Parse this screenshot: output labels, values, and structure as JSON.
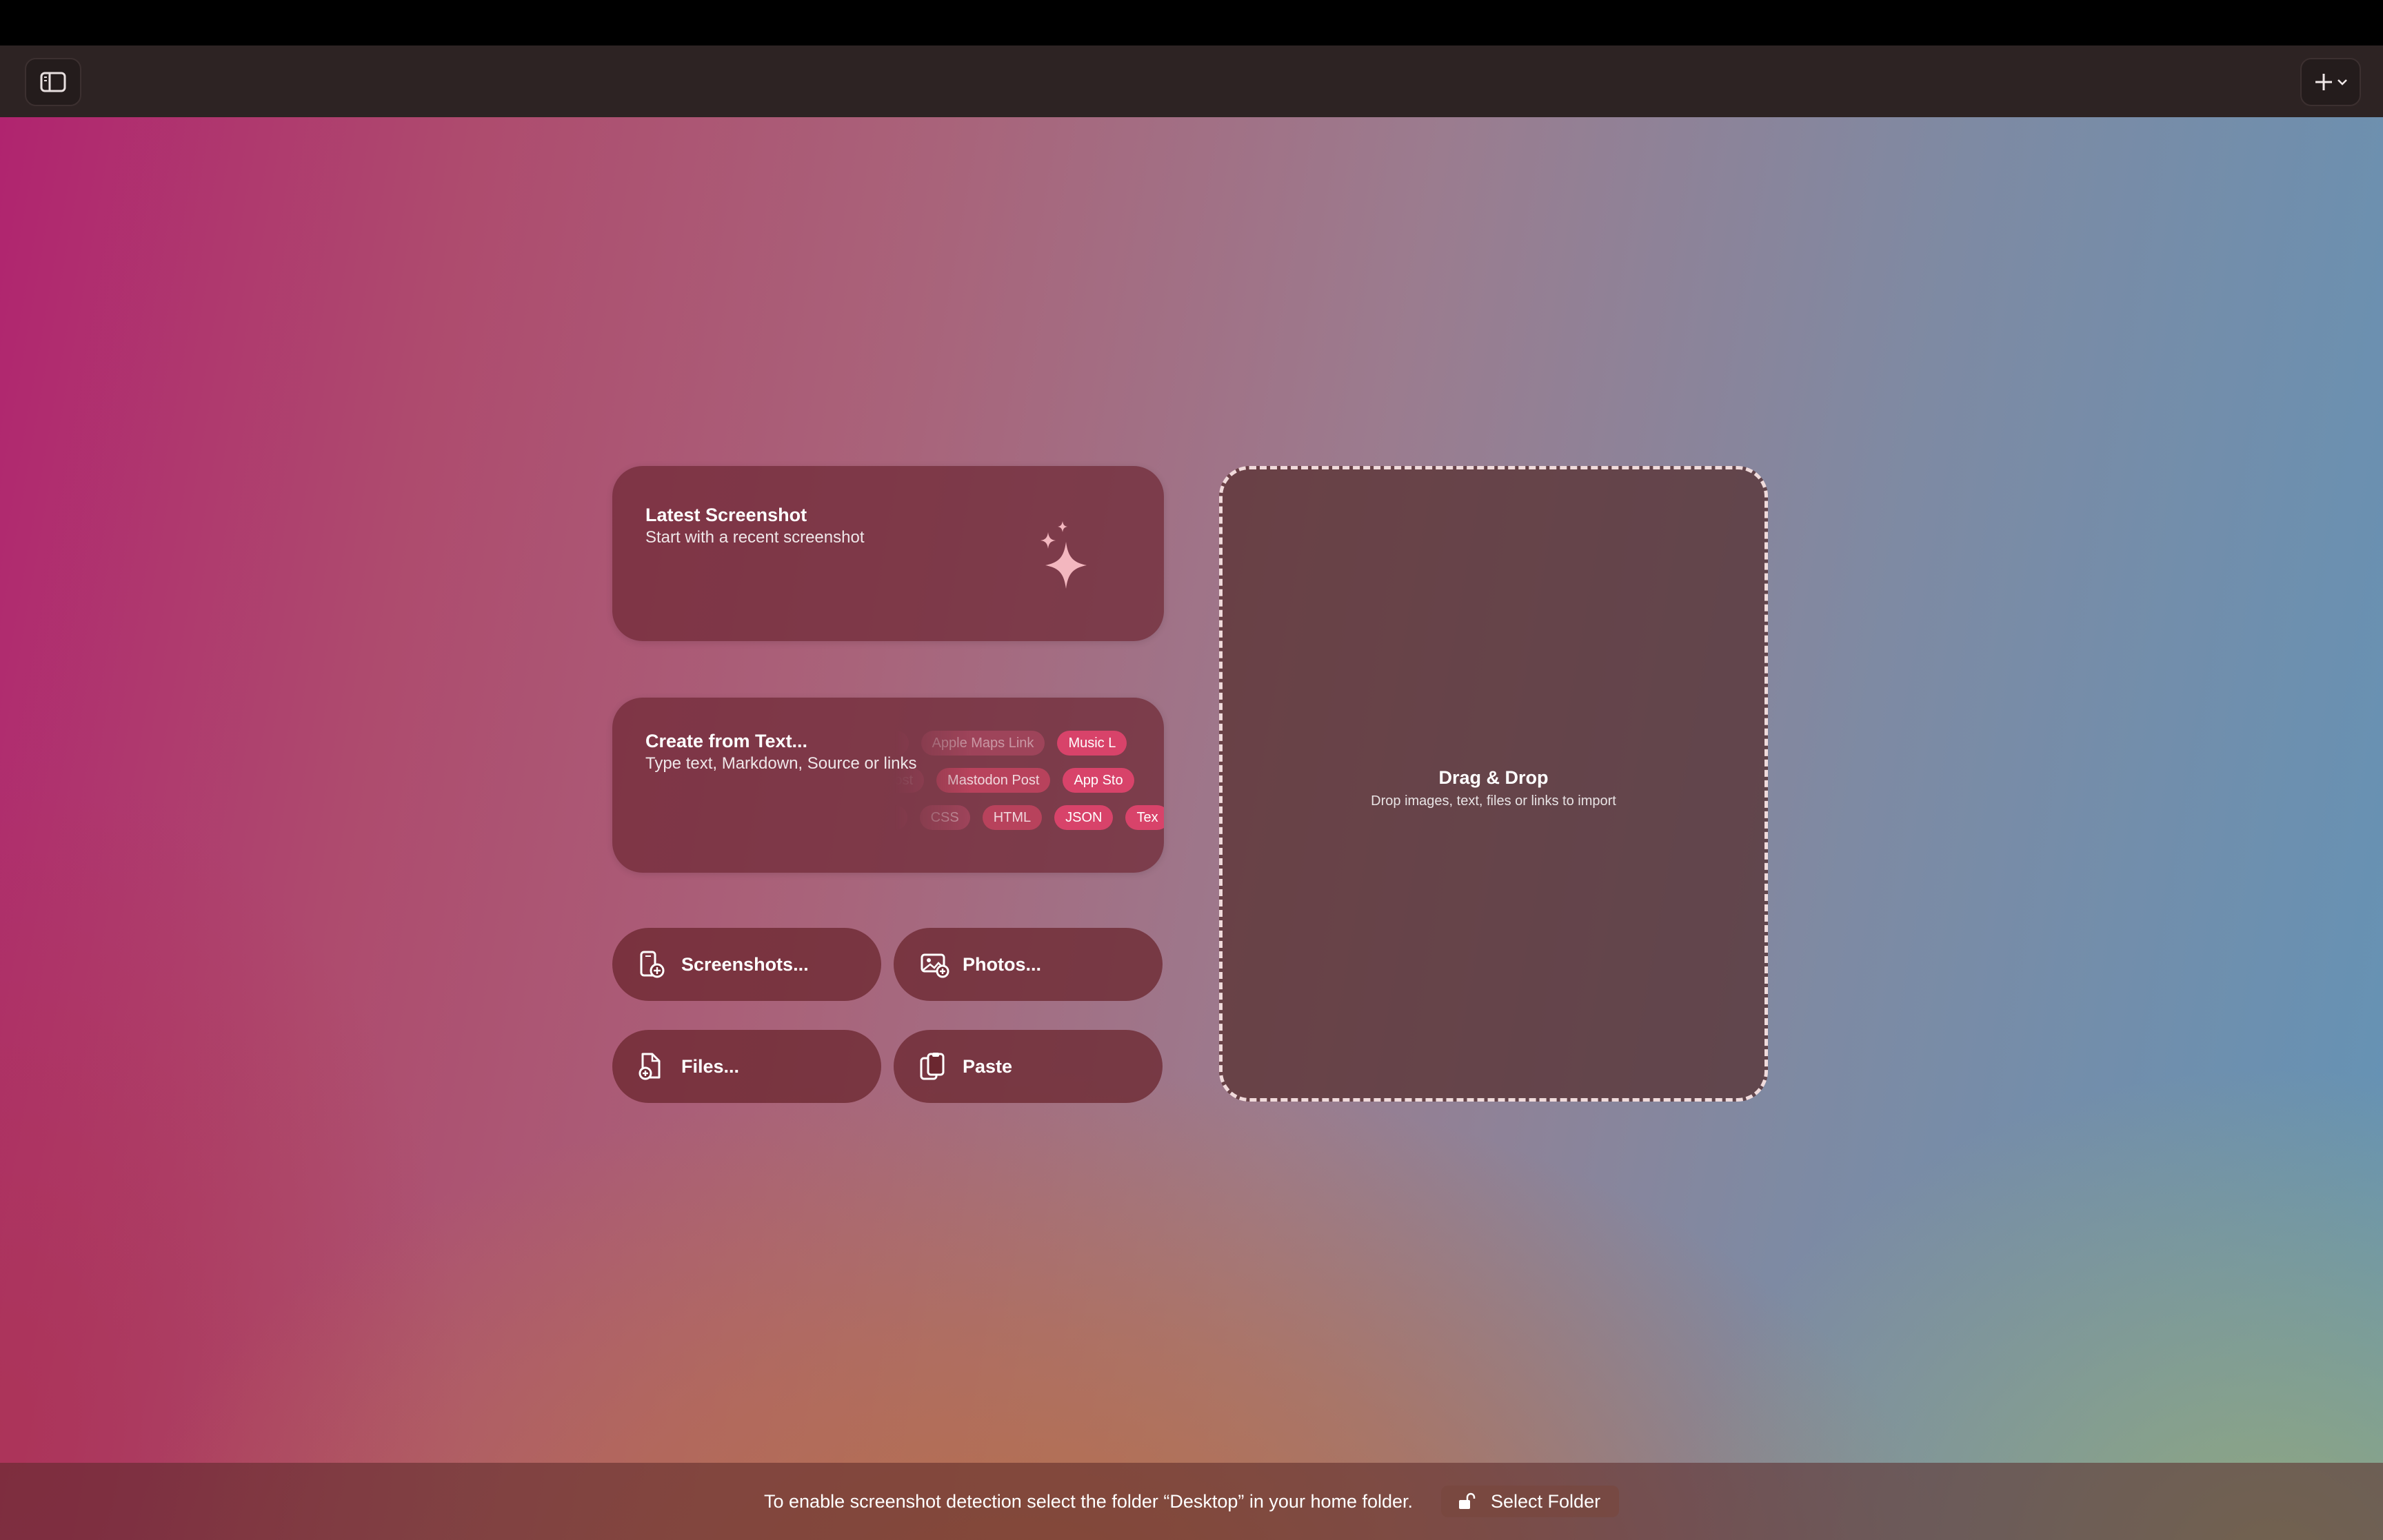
{
  "toolbar": {
    "sidebar_icon": "sidebar-toggle-icon",
    "add_icon": "plus-icon",
    "add_menu_icon": "chevron-down-icon"
  },
  "cards": {
    "latest_screenshot": {
      "title": "Latest Screenshot",
      "subtitle": "Start with a recent screenshot",
      "icon": "sparkles-icon"
    },
    "create_from_text": {
      "title": "Create from Text...",
      "subtitle": "Type text, Markdown, Source or links",
      "chip_rows": [
        [
          "Apple Maps Link",
          " Music L"
        ],
        [
          "Post",
          "Mastodon Post",
          "App Sto"
        ],
        [
          "CSS",
          "HTML",
          "JSON",
          "Tex"
        ]
      ]
    }
  },
  "buttons": {
    "screenshots": {
      "label": "Screenshots...",
      "icon": "phone-screenshot-add-icon"
    },
    "photos": {
      "label": "Photos...",
      "icon": "photo-add-icon"
    },
    "files": {
      "label": "Files...",
      "icon": "document-add-icon"
    },
    "paste": {
      "label": "Paste",
      "icon": "clipboard-icon"
    }
  },
  "dropzone": {
    "title": "Drag & Drop",
    "subtitle": "Drop images, text, files or links to import"
  },
  "footer": {
    "message": "To enable screenshot detection select the folder “Desktop” in your home folder.",
    "select_label": "Select Folder",
    "lock_icon": "unlock-icon"
  },
  "colors": {
    "accent_chip": "#d8436a",
    "toolbar": "#2d2323"
  }
}
